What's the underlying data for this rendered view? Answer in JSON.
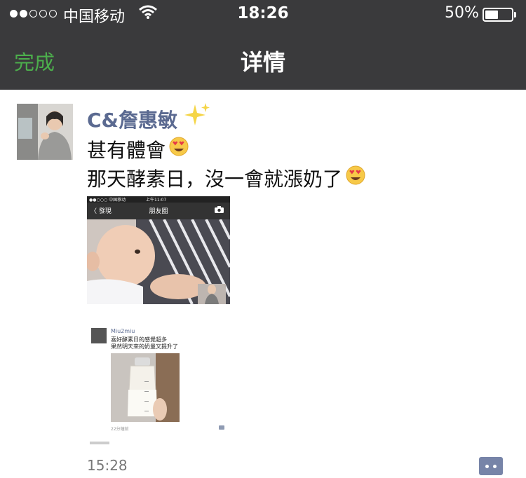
{
  "status_bar": {
    "carrier": "中国移动",
    "time": "18:26",
    "battery": "50%",
    "battery_level": 0.5
  },
  "nav": {
    "done_label": "完成",
    "title": "详情"
  },
  "post": {
    "username": "C&詹惠敏",
    "lines": [
      "甚有體會",
      "那天酵素日，沒一會就漲奶了"
    ],
    "time": "15:28"
  },
  "screenshot": {
    "status_text": "●●○○○ 中国移动",
    "status_time": "上午11:07",
    "back_label": "〈 發現",
    "title": "朋友圈",
    "inner_username": "Miu2miu",
    "inner_text_lines": [
      "喜好酵素日的感覺超多",
      "果然明天來的奶量又提升了"
    ],
    "inner_time": "22分鐘前"
  },
  "colors": {
    "header": "#3a3a3c",
    "accent_green": "#4cae4c",
    "username": "#5b6a91"
  }
}
